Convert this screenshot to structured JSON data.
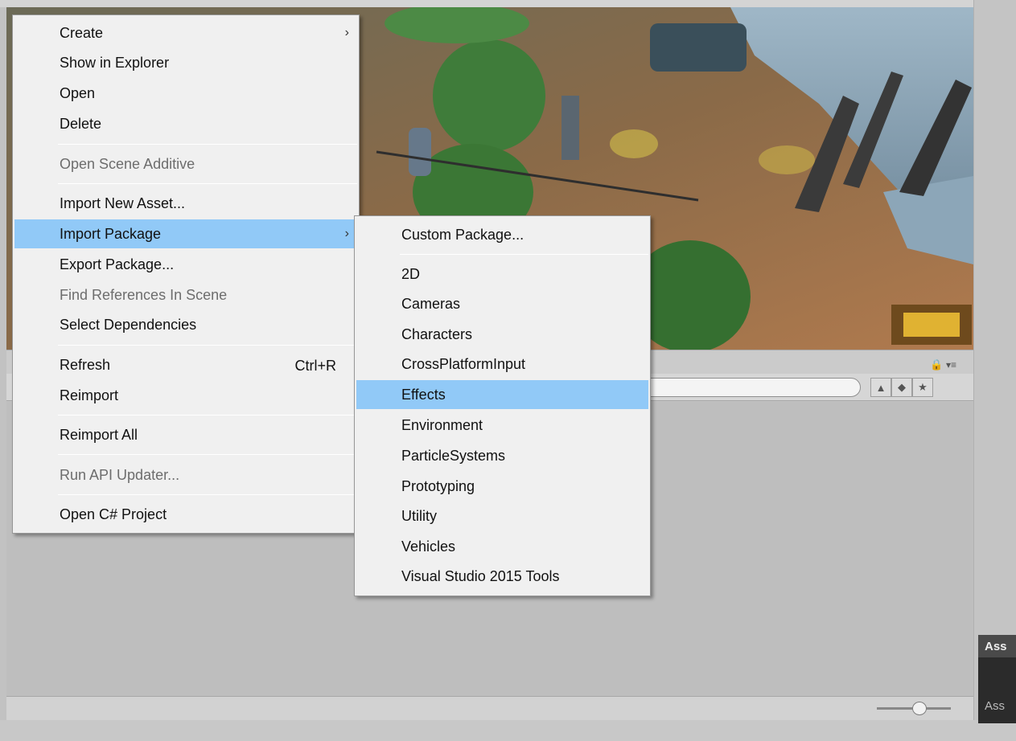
{
  "context_menu": {
    "items": [
      {
        "label": "Create",
        "arrow": "›",
        "shortcut": "",
        "disabled": false,
        "highlight": false
      },
      {
        "label": "Show in Explorer",
        "arrow": "",
        "shortcut": "",
        "disabled": false,
        "highlight": false
      },
      {
        "label": "Open",
        "arrow": "",
        "shortcut": "",
        "disabled": false,
        "highlight": false
      },
      {
        "label": "Delete",
        "arrow": "",
        "shortcut": "",
        "disabled": false,
        "highlight": false
      },
      {
        "label": "Open Scene Additive",
        "arrow": "",
        "shortcut": "",
        "disabled": true,
        "highlight": false
      },
      {
        "label": "Import New Asset...",
        "arrow": "",
        "shortcut": "",
        "disabled": false,
        "highlight": false
      },
      {
        "label": "Import Package",
        "arrow": "›",
        "shortcut": "",
        "disabled": false,
        "highlight": true
      },
      {
        "label": "Export Package...",
        "arrow": "",
        "shortcut": "",
        "disabled": false,
        "highlight": false
      },
      {
        "label": "Find References In Scene",
        "arrow": "",
        "shortcut": "",
        "disabled": true,
        "highlight": false
      },
      {
        "label": "Select Dependencies",
        "arrow": "",
        "shortcut": "",
        "disabled": false,
        "highlight": false
      },
      {
        "label": "Refresh",
        "arrow": "",
        "shortcut": "Ctrl+R",
        "disabled": false,
        "highlight": false
      },
      {
        "label": "Reimport",
        "arrow": "",
        "shortcut": "",
        "disabled": false,
        "highlight": false
      },
      {
        "label": "Reimport All",
        "arrow": "",
        "shortcut": "",
        "disabled": false,
        "highlight": false
      },
      {
        "label": "Run API Updater...",
        "arrow": "",
        "shortcut": "",
        "disabled": true,
        "highlight": false
      },
      {
        "label": "Open C# Project",
        "arrow": "",
        "shortcut": "",
        "disabled": false,
        "highlight": false
      }
    ]
  },
  "import_package_submenu": {
    "items": [
      {
        "label": "Custom Package...",
        "highlight": false
      },
      {
        "label": "2D",
        "highlight": false
      },
      {
        "label": "Cameras",
        "highlight": false
      },
      {
        "label": "Characters",
        "highlight": false
      },
      {
        "label": "CrossPlatformInput",
        "highlight": false
      },
      {
        "label": "Effects",
        "highlight": true
      },
      {
        "label": "Environment",
        "highlight": false
      },
      {
        "label": "ParticleSystems",
        "highlight": false
      },
      {
        "label": "Prototyping",
        "highlight": false
      },
      {
        "label": "Utility",
        "highlight": false
      },
      {
        "label": "Vehicles",
        "highlight": false
      },
      {
        "label": "Visual Studio 2015 Tools",
        "highlight": false
      }
    ]
  },
  "asset_panel": {
    "header": "Ass",
    "footer": "Ass"
  },
  "icons": {
    "lock": "🔒",
    "panel_menu": "▾≡",
    "filter_by_type": "▲",
    "filter_by_label": "◆",
    "favorites": "★"
  },
  "colors": {
    "menu_bg": "#f0f0f0",
    "highlight": "#91c9f7",
    "disabled_text": "#6d6d6d"
  }
}
